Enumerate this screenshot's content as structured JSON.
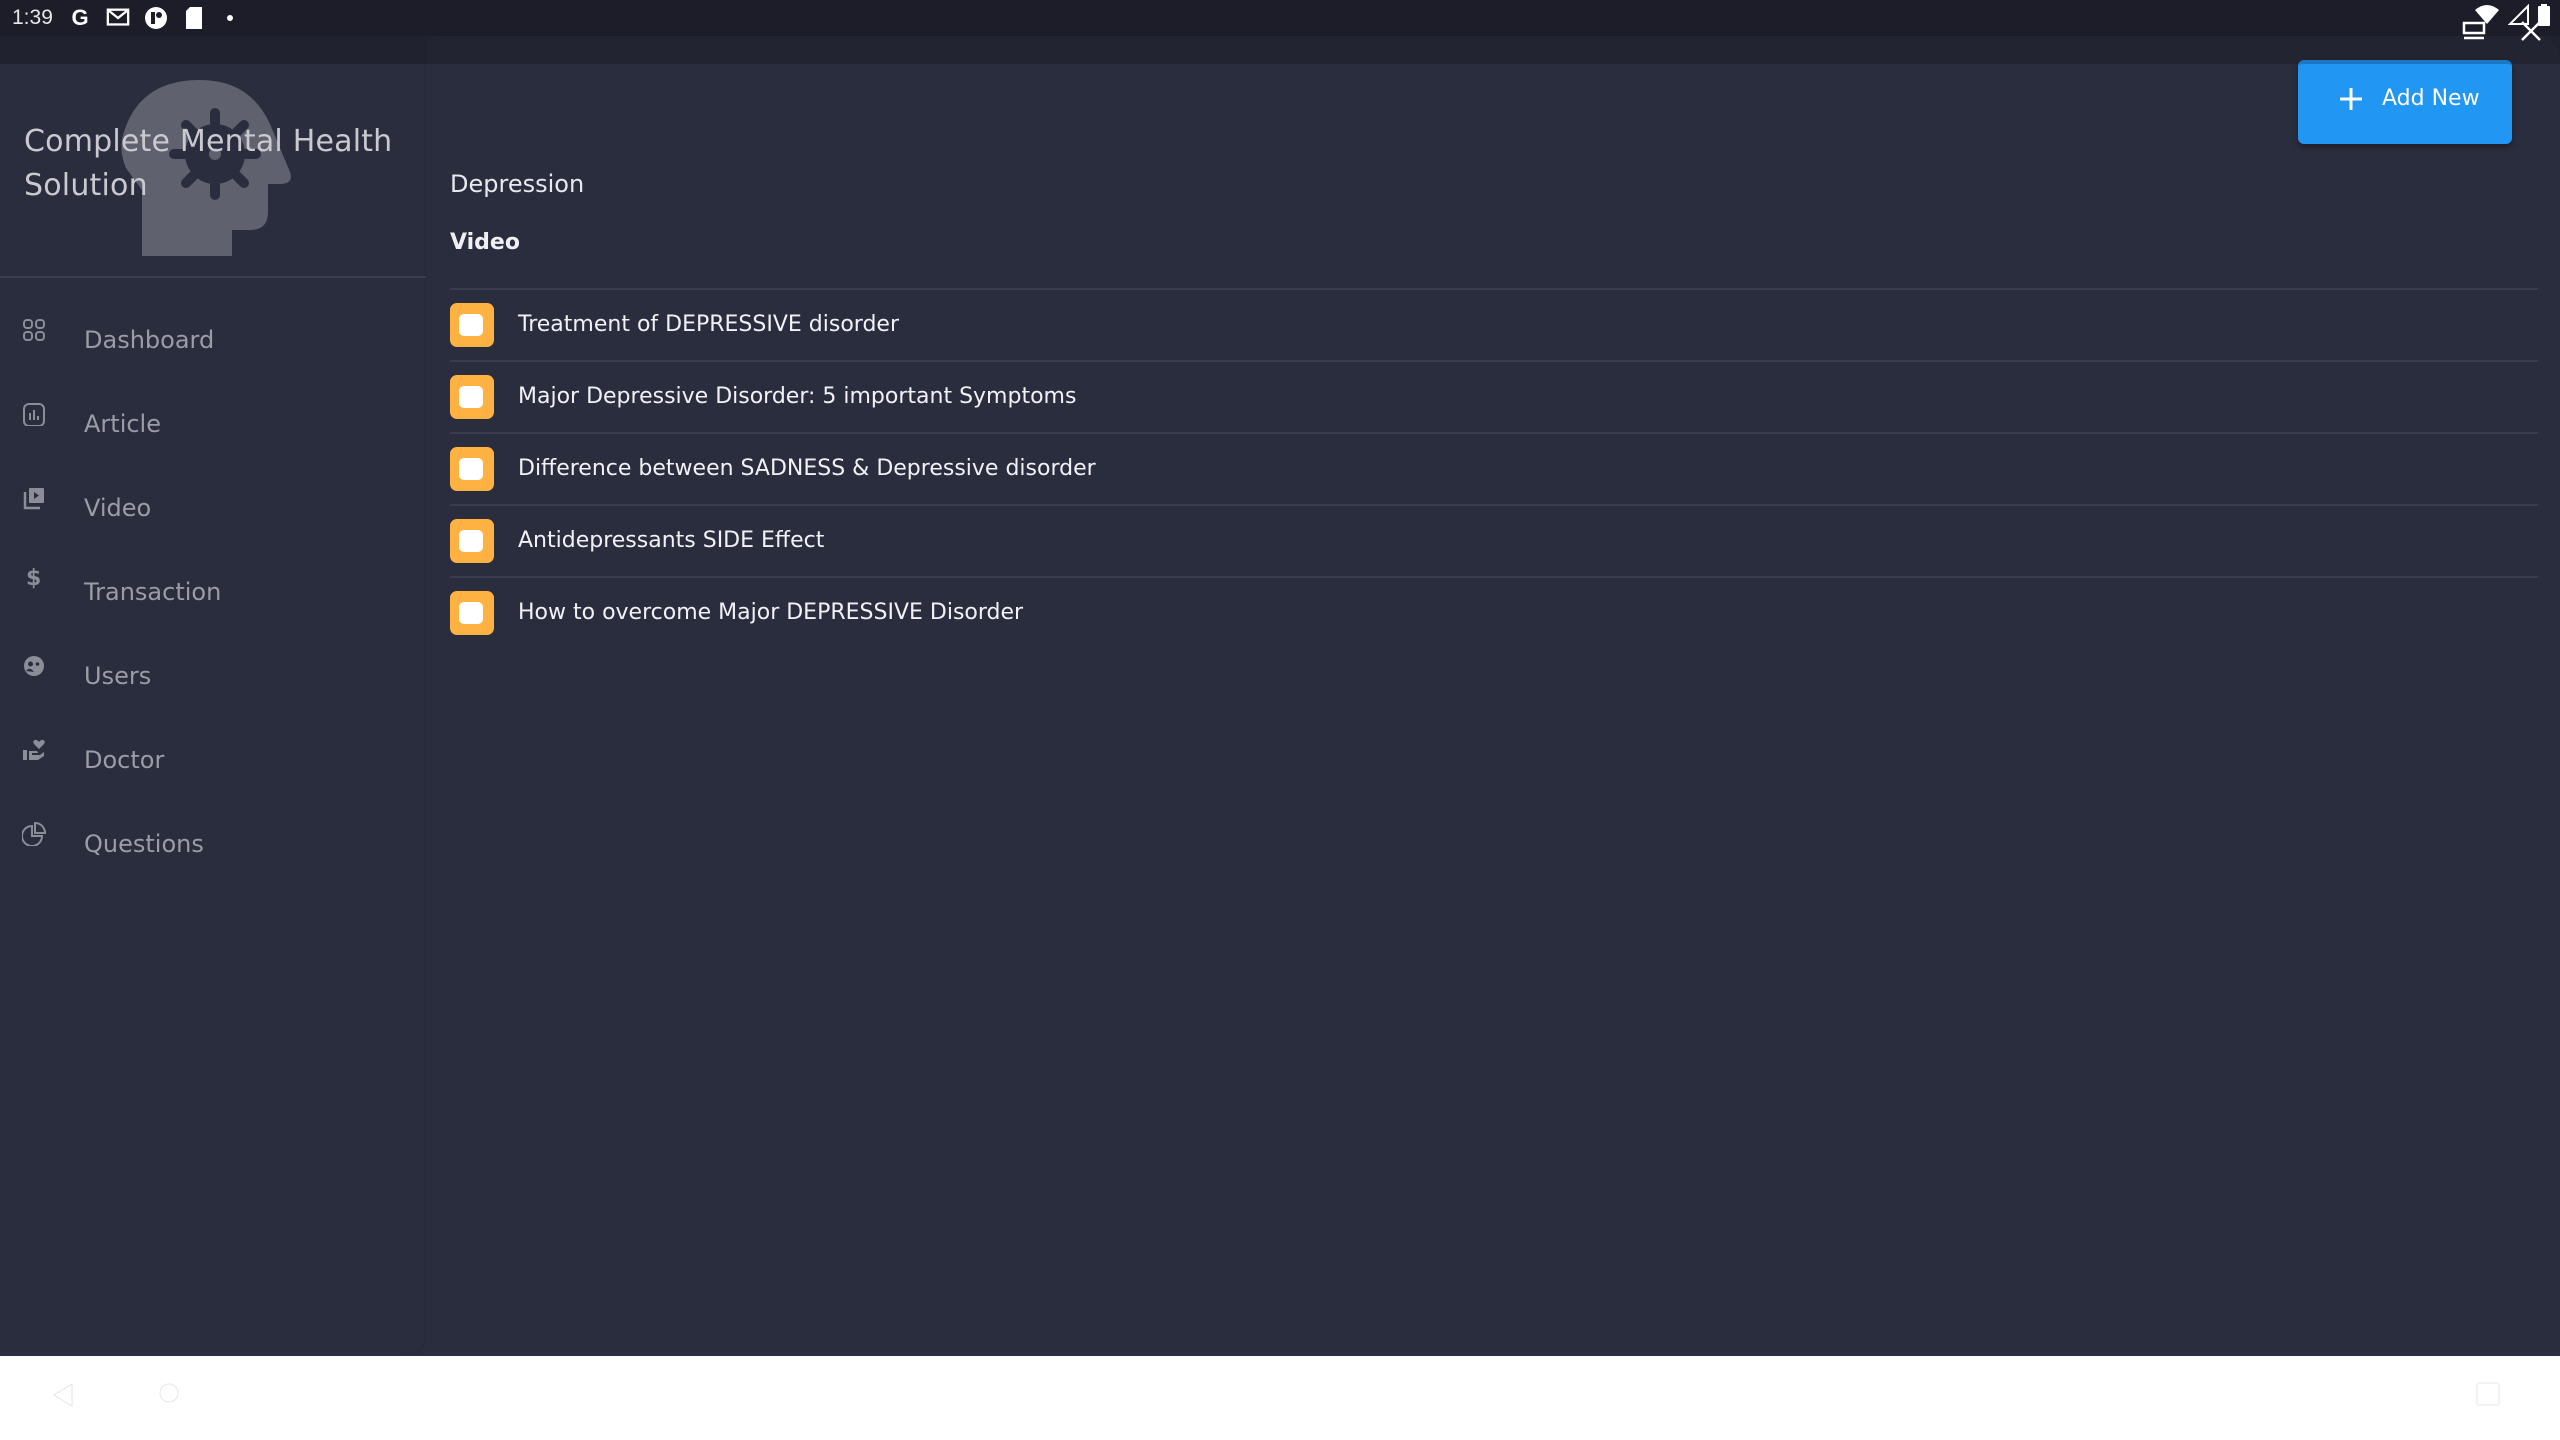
{
  "status_bar": {
    "time": "1:39",
    "notification_icons": [
      "google-icon",
      "gmail-icon",
      "app-icon",
      "sd-card-icon",
      "more-dot-icon"
    ],
    "system_icons": [
      "wifi-icon",
      "signal-icon",
      "battery-icon"
    ]
  },
  "window_controls": {
    "restore_icon": "restore-window-icon",
    "close_icon": "close-icon"
  },
  "brand": {
    "title": "Complete Mental Health Solution",
    "logo_icon": "head-gear-icon"
  },
  "sidebar": {
    "items": [
      {
        "label": "Dashboard",
        "icon": "dashboard-grid-icon"
      },
      {
        "label": "Article",
        "icon": "chart-bar-icon"
      },
      {
        "label": "Video",
        "icon": "video-library-icon"
      },
      {
        "label": "Transaction",
        "icon": "dollar-icon"
      },
      {
        "label": "Users",
        "icon": "users-face-icon"
      },
      {
        "label": "Doctor",
        "icon": "hand-heart-icon"
      },
      {
        "label": "Questions",
        "icon": "pie-chart-icon"
      }
    ]
  },
  "main": {
    "add_button_label": "Add New",
    "breadcrumb": "Depression",
    "section_title": "Video",
    "videos": [
      {
        "title": "Treatment of DEPRESSIVE disorder"
      },
      {
        "title": "Major Depressive Disorder: 5 important Symptoms"
      },
      {
        "title": "Difference between SADNESS & Depressive disorder"
      },
      {
        "title": "Antidepressants SIDE Effect"
      },
      {
        "title": "How to overcome Major DEPRESSIVE Disorder"
      }
    ]
  },
  "colors": {
    "accent": "#2196f3",
    "badge": "#ffb142",
    "background": "#2a2d3e"
  }
}
